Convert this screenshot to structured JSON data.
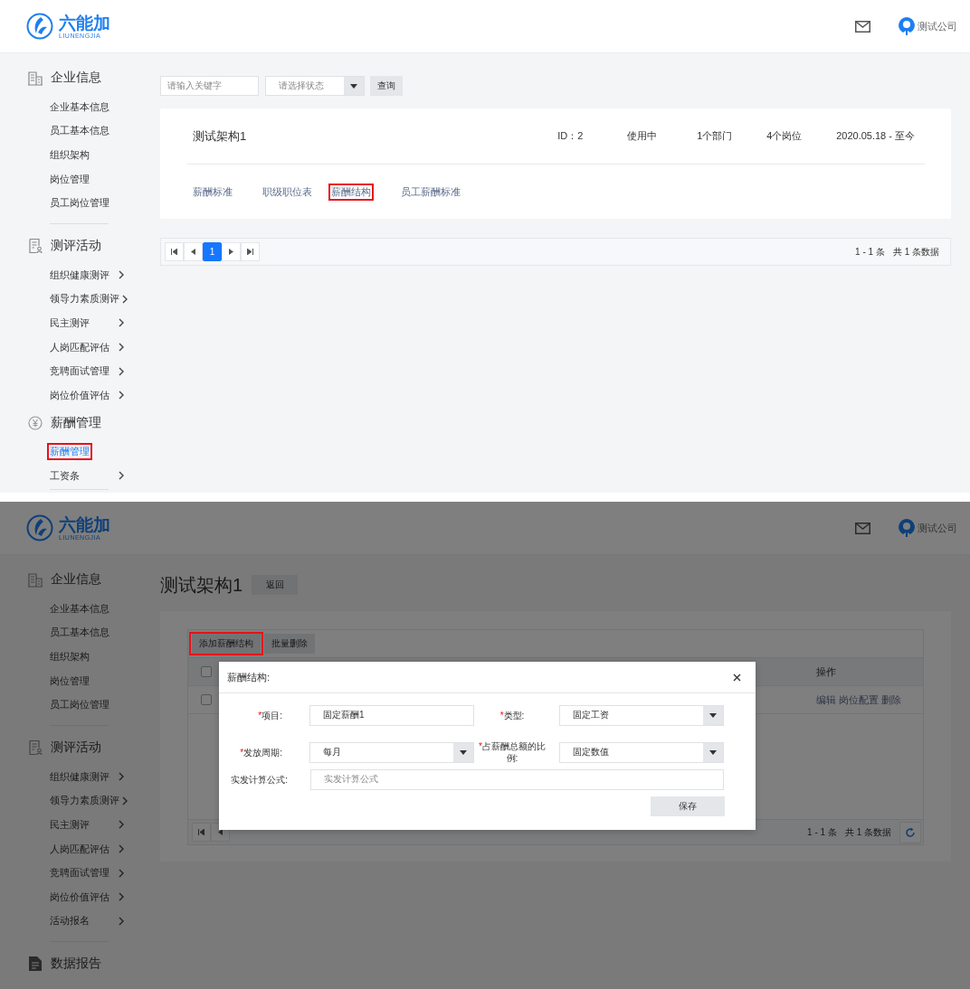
{
  "screens": [
    {
      "kind": "list",
      "header": {
        "logo_text": "六能加",
        "logo_subtext": "LIUNENGJIA",
        "user_name": "测试公司"
      },
      "sidebar": {
        "sections": [
          {
            "kind": "building",
            "title": "企业信息",
            "divider": true,
            "items": [
              {
                "label": "企业基本信息",
                "submenu": false,
                "selected": false,
                "annotated": false
              },
              {
                "label": "员工基本信息",
                "submenu": false,
                "selected": false,
                "annotated": false
              },
              {
                "label": "组织架构",
                "submenu": false,
                "selected": false,
                "annotated": false
              },
              {
                "label": "岗位管理",
                "submenu": false,
                "selected": false,
                "annotated": false
              },
              {
                "label": "员工岗位管理",
                "submenu": false,
                "selected": false,
                "annotated": false
              }
            ]
          },
          {
            "kind": "clipboard",
            "title": "测评活动",
            "divider": false,
            "items": [
              {
                "label": "组织健康测评",
                "submenu": true,
                "selected": false,
                "annotated": false
              },
              {
                "label": "领导力素质测评",
                "submenu": true,
                "selected": false,
                "annotated": false
              },
              {
                "label": "民主测评",
                "submenu": true,
                "selected": false,
                "annotated": false
              },
              {
                "label": "人岗匹配评估",
                "submenu": true,
                "selected": false,
                "annotated": false
              },
              {
                "label": "竞聘面试管理",
                "submenu": true,
                "selected": false,
                "annotated": false
              },
              {
                "label": "岗位价值评估",
                "submenu": true,
                "selected": false,
                "annotated": false
              }
            ]
          },
          {
            "kind": "yen",
            "title": "薪酬管理",
            "divider": true,
            "items": [
              {
                "label": "薪酬管理",
                "submenu": false,
                "selected": true,
                "annotated": true
              },
              {
                "label": "工资条",
                "submenu": true,
                "selected": false,
                "annotated": false
              }
            ]
          }
        ]
      },
      "filters": {
        "keyword_placeholder": "请输入关键字",
        "status_placeholder": "请选择状态",
        "search_button": "查询"
      },
      "card": {
        "name": "测试架构1",
        "meta": [
          "ID：2",
          "使用中",
          "1个部门",
          "4个岗位",
          "2020.05.18 - 至今"
        ],
        "links": [
          {
            "label": "薪酬标准",
            "annotated": false
          },
          {
            "label": "职级职位表",
            "annotated": false
          },
          {
            "label": "薪酬结构",
            "annotated": true
          },
          {
            "label": "员工薪酬标准",
            "annotated": false
          }
        ]
      },
      "pagination": {
        "pages": [
          {
            "label": "1",
            "selected": true
          }
        ],
        "range": "1 - 1 条",
        "total": "共 1 条数据"
      }
    },
    {
      "kind": "detail",
      "header": {
        "logo_text": "六能加",
        "logo_subtext": "LIUNENGJIA",
        "user_name": "测试公司"
      },
      "sidebar": {
        "sections": [
          {
            "kind": "building",
            "title": "企业信息",
            "divider": true,
            "items": [
              {
                "label": "企业基本信息",
                "submenu": false,
                "selected": false,
                "annotated": false
              },
              {
                "label": "员工基本信息",
                "submenu": false,
                "selected": false,
                "annotated": false
              },
              {
                "label": "组织架构",
                "submenu": false,
                "selected": false,
                "annotated": false
              },
              {
                "label": "岗位管理",
                "submenu": false,
                "selected": false,
                "annotated": false
              },
              {
                "label": "员工岗位管理",
                "submenu": false,
                "selected": false,
                "annotated": false
              }
            ]
          },
          {
            "kind": "clipboard",
            "title": "测评活动",
            "divider": true,
            "items": [
              {
                "label": "组织健康测评",
                "submenu": true,
                "selected": false,
                "annotated": false
              },
              {
                "label": "领导力素质测评",
                "submenu": true,
                "selected": false,
                "annotated": false
              },
              {
                "label": "民主测评",
                "submenu": true,
                "selected": false,
                "annotated": false
              },
              {
                "label": "人岗匹配评估",
                "submenu": true,
                "selected": false,
                "annotated": false
              },
              {
                "label": "竞聘面试管理",
                "submenu": true,
                "selected": false,
                "annotated": false
              },
              {
                "label": "岗位价值评估",
                "submenu": true,
                "selected": false,
                "annotated": false
              },
              {
                "label": "活动报名",
                "submenu": true,
                "selected": false,
                "annotated": false
              }
            ]
          },
          {
            "kind": "document",
            "title": "数据报告",
            "divider": false
          }
        ]
      },
      "title": "测试架构1",
      "back_button": "返回",
      "toolbar": [
        {
          "label": "添加薪酬结构",
          "annotated": true
        },
        {
          "label": "批量删除",
          "annotated": false
        }
      ],
      "table": {
        "header": {
          "checked": false,
          "actions_heading": "操作"
        },
        "rows": [
          {
            "checked": false,
            "actions": [
              "编辑",
              "岗位配置",
              "删除"
            ]
          }
        ]
      },
      "pagination": {
        "range": "1 - 1 条",
        "total": "共 1 条数据"
      },
      "dialog": {
        "title": "薪酬结构:",
        "rows": [
          [
            {
              "required_mark": "*",
              "label": "项目:",
              "kind": "input",
              "value": "固定薪酬1"
            },
            {
              "required_mark": "*",
              "label": "类型:",
              "kind": "select",
              "value": "固定工资"
            }
          ],
          [
            {
              "required_mark": "*",
              "label": "发放周期:",
              "kind": "select",
              "value": "每月"
            },
            {
              "required_mark": "*",
              "label": "占薪酬总额的比例:",
              "kind": "select",
              "value": "固定数值"
            }
          ],
          [
            {
              "label": "实发计算公式:",
              "kind": "input",
              "placeholder": "实发计算公式"
            }
          ]
        ],
        "save_button": "保存"
      }
    }
  ]
}
